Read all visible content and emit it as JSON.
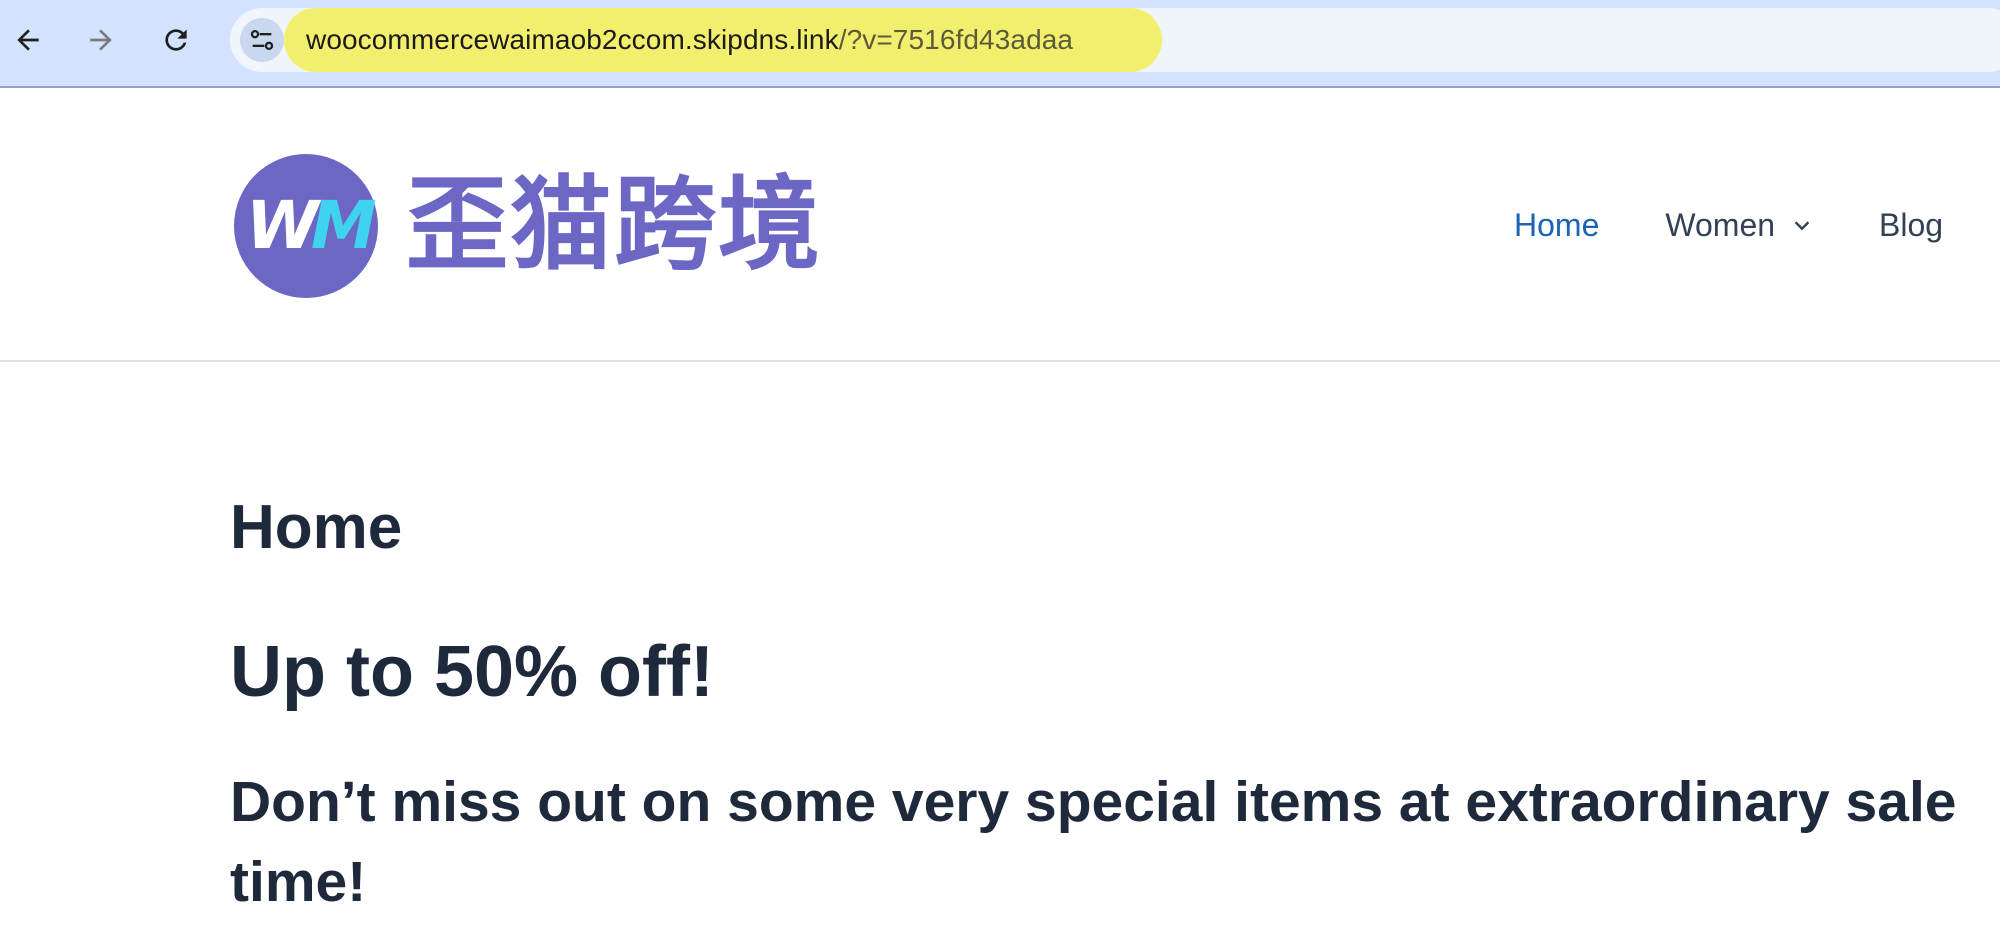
{
  "browser": {
    "back_icon": "arrow-left-icon",
    "forward_icon": "arrow-right-icon",
    "reload_icon": "reload-icon",
    "site_info_icon": "tune-icon",
    "url_host": "woocommercewaimaob2ccom.skipdns.link",
    "url_path": "/?v=7516fd43adaa",
    "highlight_color": "#f3ef6e"
  },
  "header": {
    "logo_mark": {
      "w": "W",
      "m": "M"
    },
    "logo_text": "歪猫跨境",
    "brand_color": "#6c67c4",
    "nav": [
      {
        "label": "Home",
        "active": true
      },
      {
        "label": "Women",
        "has_dropdown": true
      },
      {
        "label": "Blog"
      }
    ]
  },
  "main": {
    "page_title": "Home",
    "promo_heading": "Up to 50% off!",
    "promo_subheading": "Don’t miss out on some very special items at extraordinary sale time!"
  }
}
